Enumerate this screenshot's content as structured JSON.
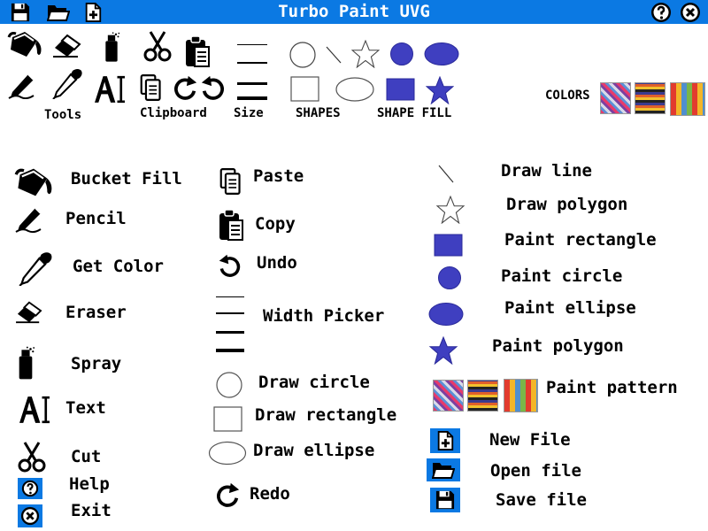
{
  "window": {
    "title": "Turbo Paint UVG"
  },
  "toolbar": {
    "labels": {
      "tools": "Tools",
      "clipboard": "Clipboard",
      "size": "Size",
      "shapes": "SHAPES",
      "shape_fill": "SHAPE FILL",
      "colors": "COLORS"
    }
  },
  "legend": {
    "bucket_fill": "Bucket Fill",
    "pencil": "Pencil",
    "get_color": "Get Color",
    "eraser": "Eraser",
    "spray": "Spray",
    "text": "Text",
    "cut": "Cut",
    "help": "Help",
    "exit": "Exit",
    "paste": "Paste",
    "copy": "Copy",
    "undo": "Undo",
    "width_picker": "Width Picker",
    "draw_circle": "Draw circle",
    "draw_rectangle": "Draw rectangle",
    "draw_ellipse": "Draw ellipse",
    "redo": "Redo",
    "draw_line": "Draw line",
    "draw_polygon": "Draw polygon",
    "paint_rectangle": "Paint rectangle",
    "paint_circle": "Paint circle",
    "paint_ellipse": "Paint ellipse",
    "paint_polygon": "Paint polygon",
    "paint_pattern": "Paint pattern",
    "new_file": "New File",
    "open_file": "Open file",
    "save_file": "Save file"
  },
  "colors": {
    "titlebar": "#0b79e3",
    "shape_fill": "#3f3fc0",
    "shape_stroke": "#2a2a9a"
  }
}
